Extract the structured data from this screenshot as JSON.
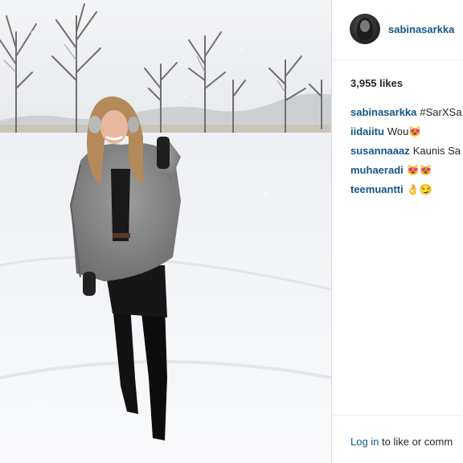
{
  "post": {
    "username": "sabinasarkka",
    "likes_text": "3,955 likes",
    "comments": [
      {
        "user": "sabinasarkka",
        "text": "#SarXSa"
      },
      {
        "user": "iidaiitu",
        "text": "Wou😻"
      },
      {
        "user": "susannaaaz",
        "text": "Kaunis Sa"
      },
      {
        "user": "muhaeradi",
        "text": "😻😻"
      },
      {
        "user": "teemuantti",
        "text": "👌😏"
      }
    ],
    "login_link": "Log in",
    "login_suffix": " to like or comm"
  },
  "colors": {
    "link_blue": "#125688",
    "text": "#262626",
    "divider": "#efefef"
  }
}
